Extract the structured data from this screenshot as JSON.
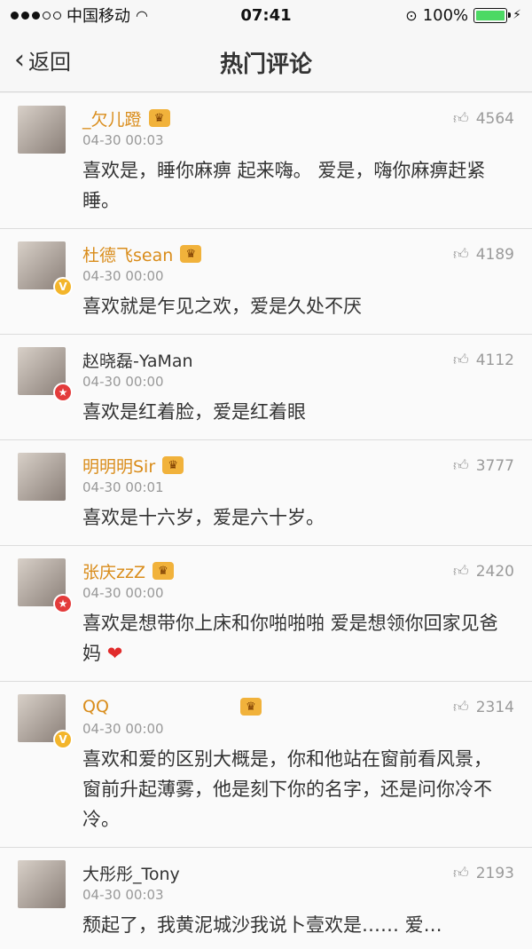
{
  "status_bar": {
    "carrier": "中国移动",
    "time": "07:41",
    "battery": "100%",
    "signal_icon": "signal-dots-icon",
    "wifi_icon": "wifi-icon"
  },
  "nav": {
    "back_label": "返回",
    "title": "热门评论"
  },
  "comments": [
    {
      "name": "_欠儿蹬",
      "time": "04-30 00:03",
      "likes": "4564",
      "text": "喜欢是，睡你麻痹 起来嗨。 爱是，嗨你麻痹赶紧睡。"
    },
    {
      "name": "杜德飞sean",
      "time": "04-30 00:00",
      "likes": "4189",
      "text": "喜欢就是乍见之欢，爱是久处不厌"
    },
    {
      "name": "赵晓磊-YaMan",
      "time": "04-30 00:00",
      "likes": "4112",
      "text": "喜欢是红着脸，爱是红着眼"
    },
    {
      "name": "明明明Sir",
      "time": "04-30 00:01",
      "likes": "3777",
      "text": "喜欢是十六岁，爱是六十岁。"
    },
    {
      "name": "张庆zzZ",
      "time": "04-30 00:00",
      "likes": "2420",
      "text": "喜欢是想带你上床和你啪啪啪 爱是想领你回家见爸妈"
    },
    {
      "name": "QQ",
      "time": "04-30 00:00",
      "likes": "2314",
      "text": "喜欢和爱的区别大概是，你和他站在窗前看风景，窗前升起薄雾，他是刻下你的名字，还是问你冷不冷。"
    },
    {
      "name": "大彤彤_Tony",
      "time": "04-30 00:03",
      "likes": "2193",
      "text": "颓起了，我黄泥城沙我说卜壹欢是…… 爱…"
    }
  ]
}
